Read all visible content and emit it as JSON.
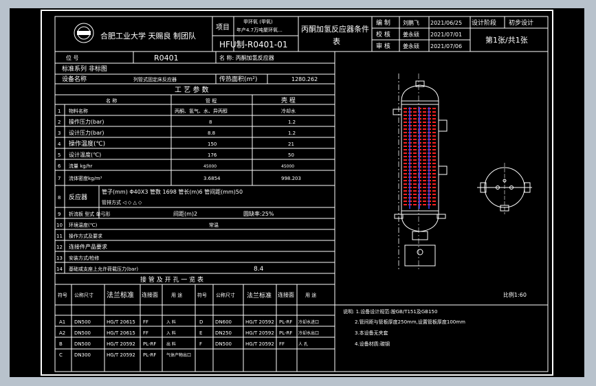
{
  "title_block": {
    "school": "合肥工业大学 天赐良 制团队",
    "project_label": "项目",
    "project_name": "年产4.7万吨聚环氧...",
    "project_line1": "甲环氧 (甲氧)",
    "drawing_code": "HFU制-R0401-01",
    "doc_title_line1": "丙酮加氢反应器条件",
    "doc_title_line2": "表",
    "row_labels": [
      "编 制",
      "校 核",
      "审 核"
    ],
    "row_names": [
      "刘鹏飞",
      "姜永硕",
      "姜永硕"
    ],
    "row_dates": [
      "2021/06/25",
      "2021/07/01",
      "2021/07/06"
    ],
    "design_stage_label": "设计阶段",
    "design_stage_value": "初步设计",
    "sheet_info": "第1张/共1张"
  },
  "equipment": {
    "code_label": "位 号",
    "code_value": "R0401",
    "name_label": "名 称: 丙酮加氢反应器",
    "spec_label": "标准系列 非标图",
    "category_label": "设备名称",
    "category_value": "列管式固定床反应器",
    "area_label": "传热面积(m²)",
    "area_value": "1280.262"
  },
  "process_params": {
    "heading": "工 艺 参 数",
    "col_name": "名 称",
    "col_tube": "管 程",
    "col_shell": "壳 程",
    "rows": [
      {
        "no": "1",
        "name": "物料名称",
        "tube": "丙酮、氢气、水、异丙醇",
        "shell": "冷却水"
      },
      {
        "no": "2",
        "name": "操作压力(bar)",
        "tube": "8",
        "shell": "1.2"
      },
      {
        "no": "3",
        "name": "设计压力(bar)",
        "tube": "8.8",
        "shell": "1.2"
      },
      {
        "no": "4",
        "name": "操作温度(℃)",
        "tube": "150",
        "shell": "21"
      },
      {
        "no": "5",
        "name": "设计温度(℃)",
        "tube": "176",
        "shell": "50"
      },
      {
        "no": "6",
        "name": "流量 kg/hr",
        "tube": "45000",
        "shell": "45000"
      },
      {
        "no": "7",
        "name": "流体密度kg/m³",
        "tube": "3.6854",
        "shell": "998.203"
      }
    ],
    "row8_no": "8",
    "row8_name": "反应器",
    "row8_line1": "管子(mm) Φ40X3  管数 1698  管长(m)6  管间距(mm)50",
    "row8_line2": "管排方式 ◁ ◇ △ ◇",
    "row9_no": "9",
    "row9_name": "折流板 型式 单弓形",
    "row9_mid": "间距(m)2",
    "row9_right": "圆缺率:25%",
    "rows_more": [
      {
        "no": "10",
        "name": "环境温度(℃)",
        "value": "常温"
      },
      {
        "no": "11",
        "name": "操作方式及要求",
        "value": ""
      },
      {
        "no": "12",
        "name": "连接件产品要求",
        "value": ""
      },
      {
        "no": "13",
        "name": "安装方式/检修",
        "value": ""
      },
      {
        "no": "14",
        "name": "基础或支座上允许荷载压力(bar)",
        "value": "8.4"
      }
    ]
  },
  "nozzle_table": {
    "heading": "接 管 及 开 孔 一 览 表",
    "headers": [
      "符号",
      "公称尺寸",
      "法兰标准",
      "连接面",
      "用 途"
    ],
    "rows": [
      [
        "A1",
        "DN500",
        "HG/T 20615",
        "FF",
        "入 料",
        "D",
        "DN600",
        "HG/T 20592",
        "PL-RF",
        "冷却水进口"
      ],
      [
        "A2",
        "DN500",
        "HG/T 20615",
        "FF",
        "入 料",
        "E",
        "DN250",
        "HG/T 20592",
        "PL-RF",
        "冷却水出口"
      ],
      [
        "B",
        "DN500",
        "HG/T 20592",
        "PL-RF",
        "出 料",
        "F",
        "DN500",
        "HG/T 20592",
        "FF",
        "人 孔"
      ],
      [
        "C",
        "DN300",
        "HG/T 20592",
        "PL-RF",
        "气体产物出口",
        "",
        "",
        "",
        "",
        ""
      ]
    ]
  },
  "notes": {
    "scale": "比例1:60",
    "lines": [
      "说明: 1.设备设计规范:按GB/T151及GB150",
      "2.管间距与管板厚度250mm,设置管板厚度100mm",
      "3.本设备无夹套",
      "4.设备材质:碳钢"
    ]
  },
  "colors": {
    "background": "#000000",
    "lines": "#ffffff",
    "tubes_red": "#ff2020",
    "tubes_blue": "#3040ff",
    "outer": "#b8c2cc"
  }
}
